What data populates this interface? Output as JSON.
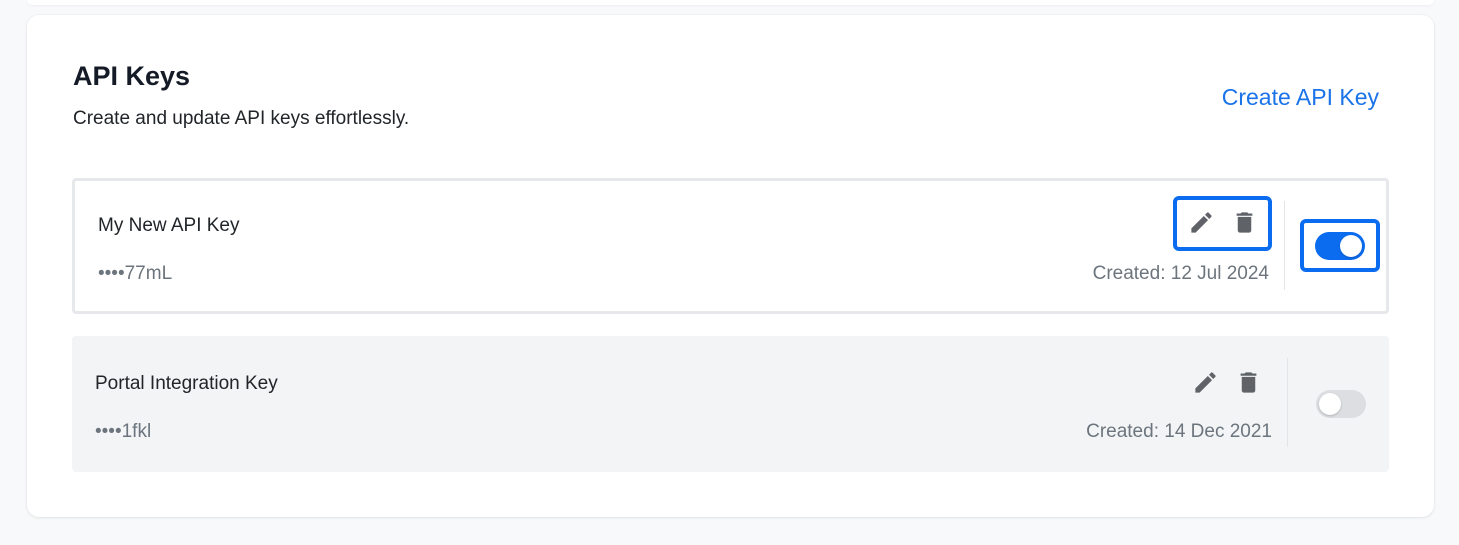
{
  "section": {
    "title": "API Keys",
    "subtitle": "Create and update API keys effortlessly.",
    "create_link": "Create API Key"
  },
  "keys": [
    {
      "name": "My New API Key",
      "masked": "••••77mL",
      "created": "Created: 12 Jul 2024",
      "enabled": true,
      "edit_icon": "pencil-icon",
      "delete_icon": "trash-icon"
    },
    {
      "name": "Portal Integration Key",
      "masked": "••••1fkl",
      "created": "Created: 14 Dec 2021",
      "enabled": false,
      "edit_icon": "pencil-icon",
      "delete_icon": "trash-icon"
    }
  ],
  "colors": {
    "accent": "#0b6cf0",
    "link": "#1a73e8",
    "muted_text": "#6c757d",
    "inactive_row_bg": "#f3f4f6",
    "icon": "#5f6368"
  }
}
